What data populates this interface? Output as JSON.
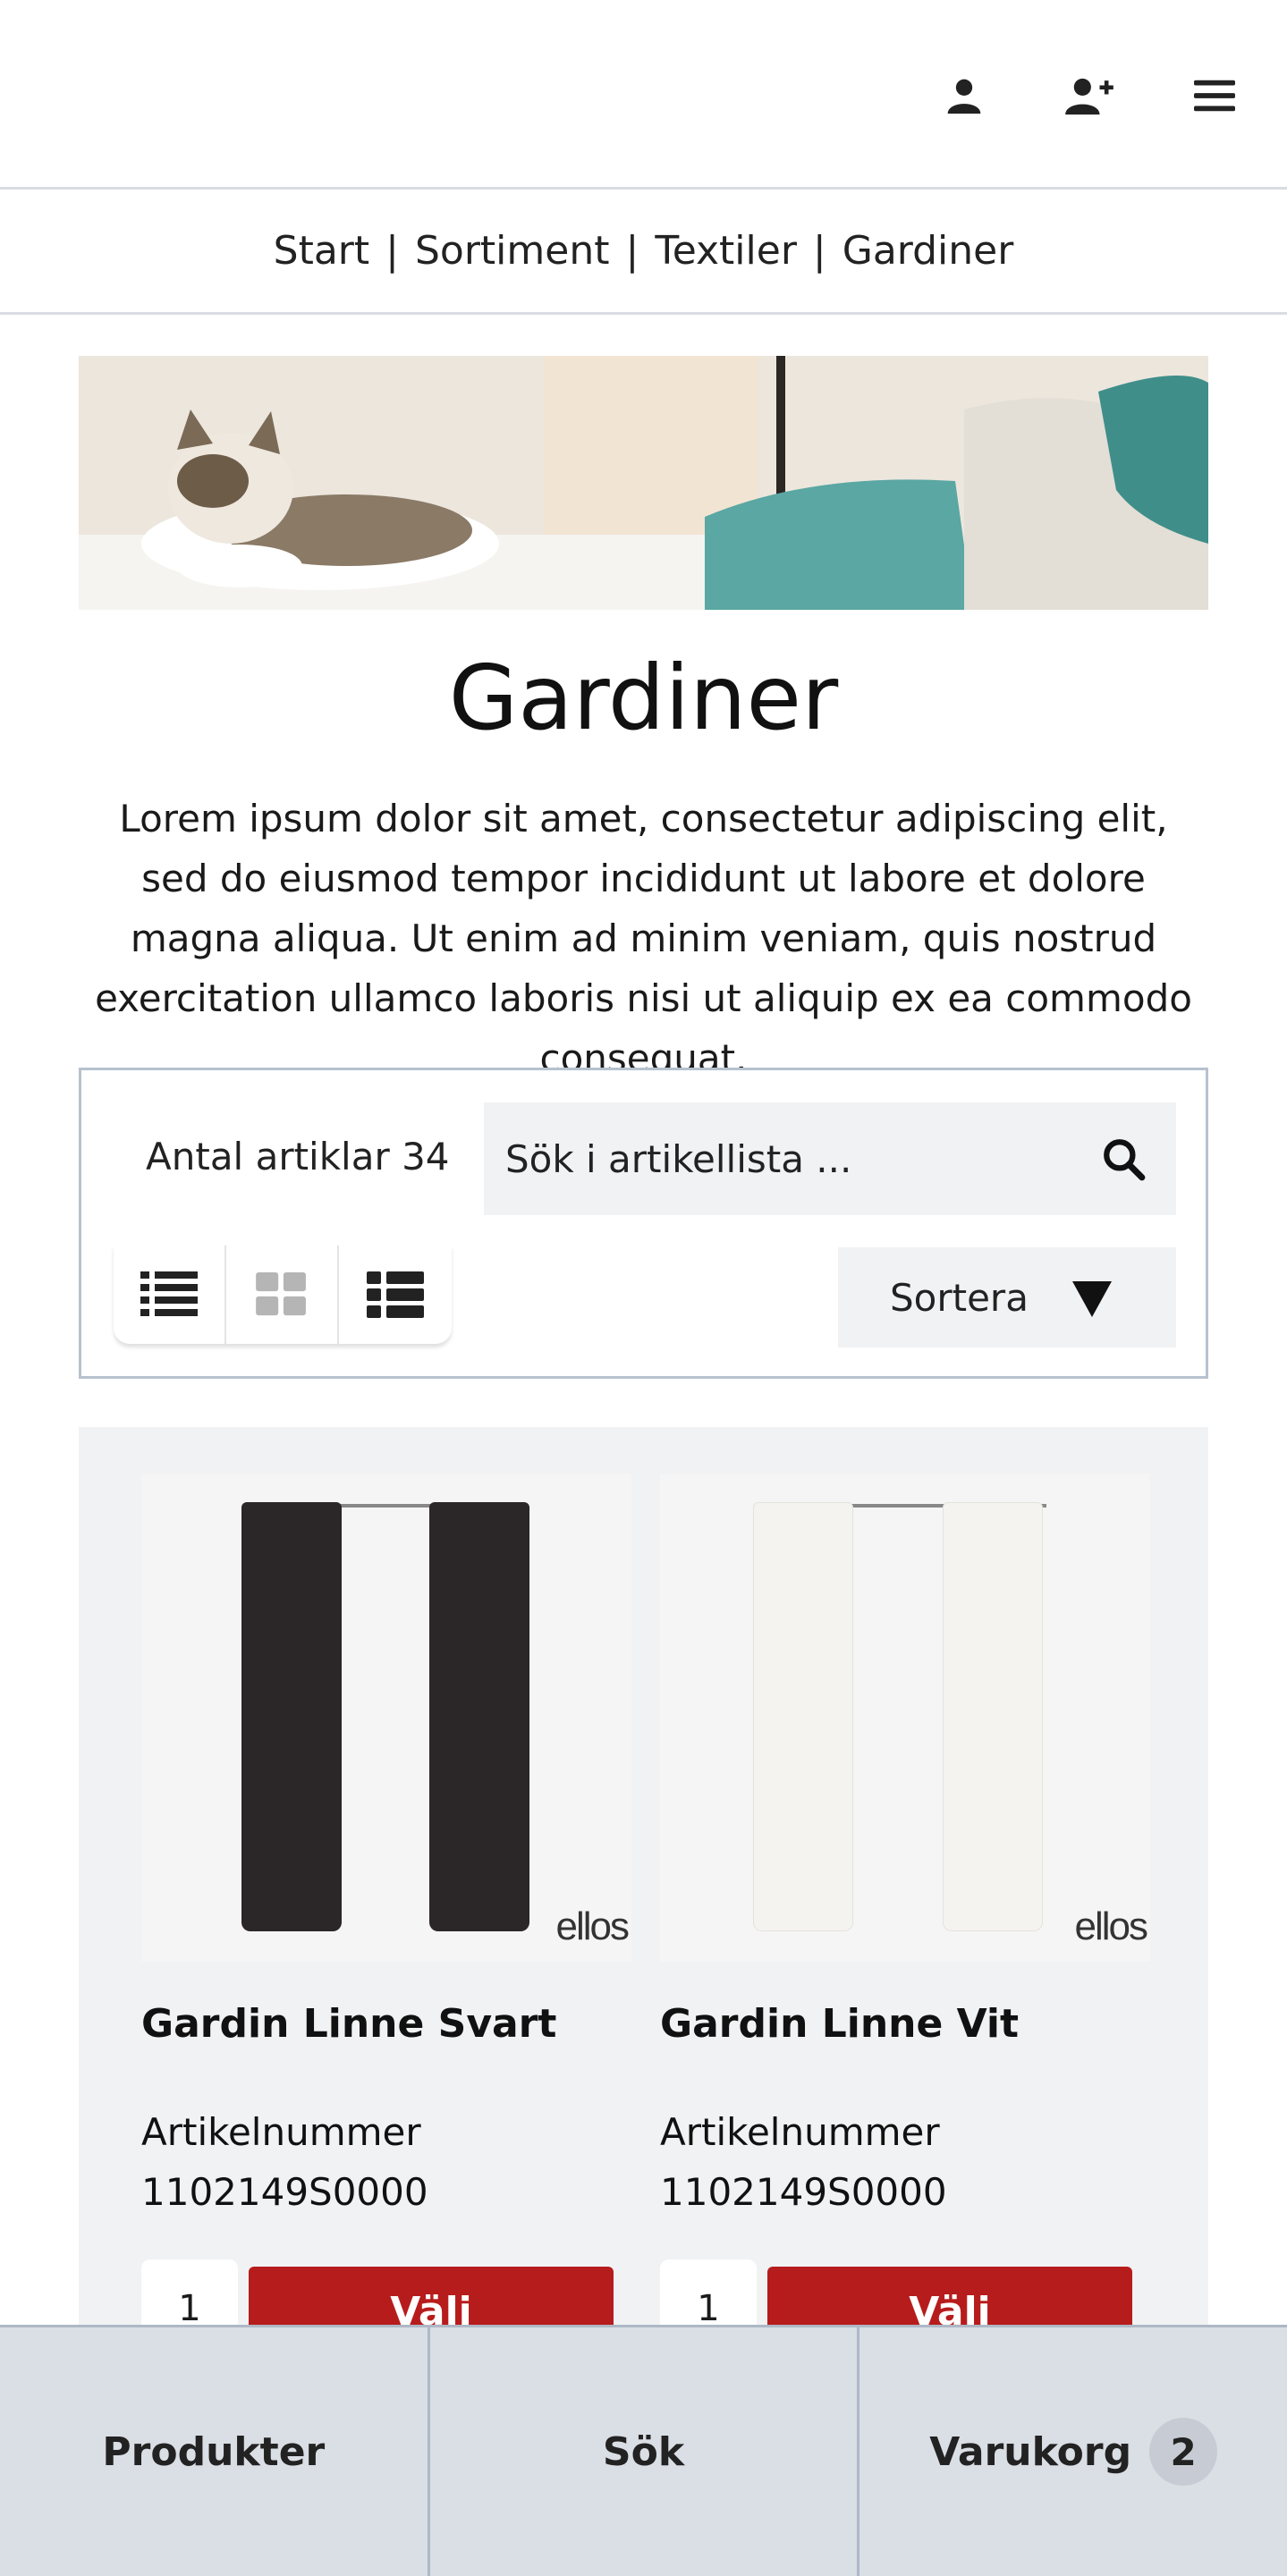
{
  "header": {
    "icons": [
      "user-icon",
      "add-user-icon",
      "menu-icon"
    ]
  },
  "breadcrumb": {
    "items": [
      "Start",
      "Sortiment",
      "Textiler",
      "Gardiner"
    ],
    "separator": "|"
  },
  "hero": {
    "image": "cat-on-sofa-banner"
  },
  "page": {
    "title": "Gardiner",
    "description": "Lorem ipsum dolor sit amet, consectetur adipiscing elit, sed do eiusmod tempor incididunt ut labore et dolore magna aliqua. Ut enim ad minim veniam, quis nostrud exercitation ullamco laboris nisi ut aliquip ex ea commodo consequat."
  },
  "toolbar": {
    "count_label": "Antal artiklar 34",
    "search_placeholder": "Sök i artikellista ...",
    "views": [
      "list-view-icon",
      "grid-view-icon",
      "detail-list-view-icon"
    ],
    "sort_label": "Sortera"
  },
  "products": [
    {
      "name": "Gardin Linne Svart",
      "article_label": "Artikelnummer",
      "article_number": "1102149S0000",
      "brand": "ellos",
      "quantity": "1",
      "buy_label": "Välj",
      "color": "#2b2628"
    },
    {
      "name": "Gardin Linne Vit",
      "article_label": "Artikelnummer",
      "article_number": "1102149S0000",
      "brand": "ellos",
      "quantity": "1",
      "buy_label": "Välj",
      "color": "#f4f3ef"
    }
  ],
  "bottom_nav": {
    "products": "Produkter",
    "search": "Sök",
    "cart": "Varukorg",
    "cart_count": "2"
  },
  "colors": {
    "accent_red": "#b71c1c",
    "panel_bg": "#f1f2f4",
    "nav_bg": "#dadee5"
  }
}
